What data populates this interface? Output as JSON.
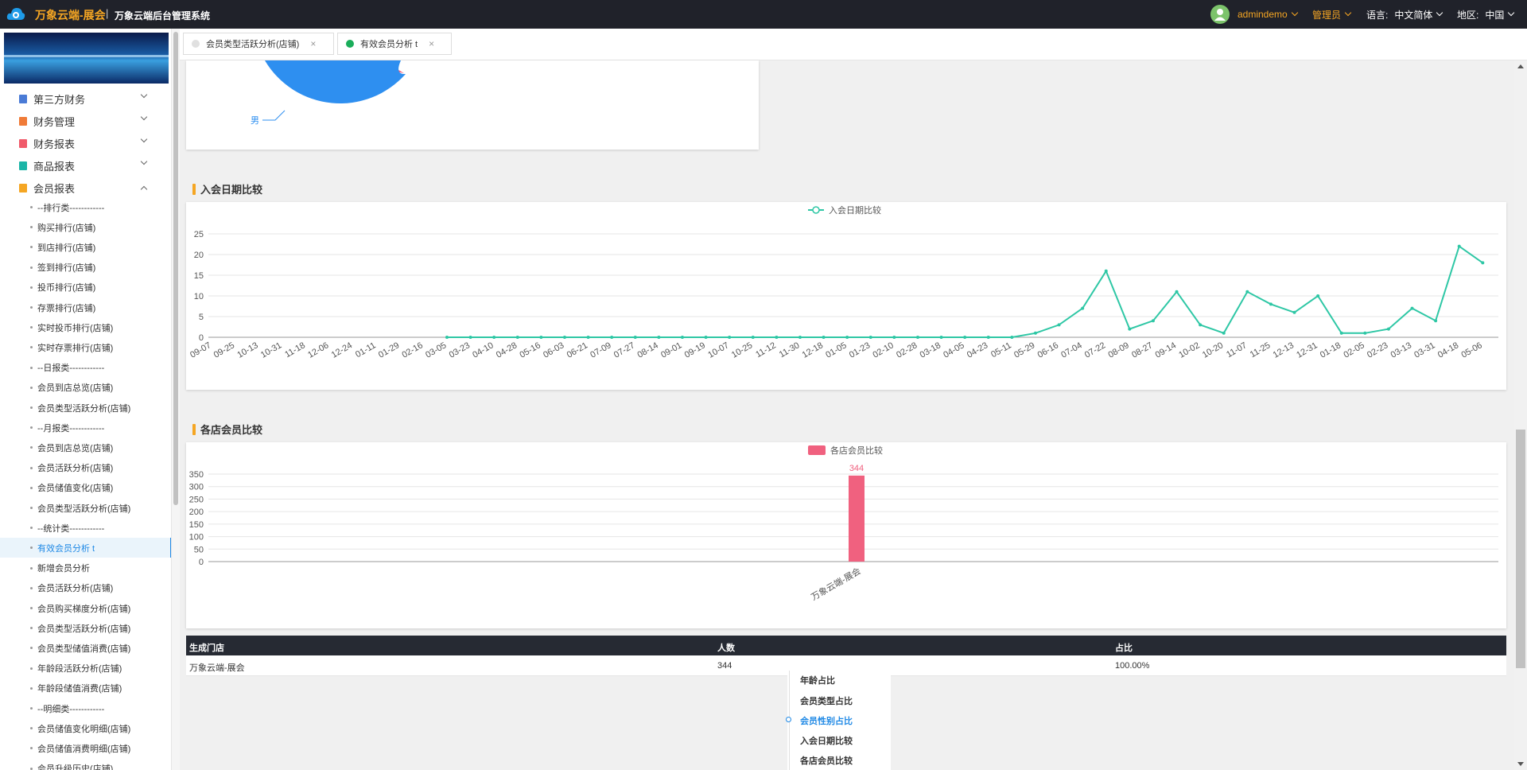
{
  "topbar": {
    "brand": "万象云端-展会",
    "separator": "|",
    "subtitle": "万象云端后台管理系统",
    "user": "admindemo",
    "role": "管理员",
    "language_label": "语言:",
    "language_value": "中文简体",
    "region_label": "地区:",
    "region_value": "中国",
    "brand_color": "#f5a623"
  },
  "sidebar": {
    "menus": [
      {
        "label": "第三方财务",
        "icon_color": "#4a7bd6",
        "icon": "document-icon"
      },
      {
        "label": "财务管理",
        "icon_color": "#f07b38",
        "icon": "ledger-icon"
      },
      {
        "label": "财务报表",
        "icon_color": "#f05a6a",
        "icon": "report-icon"
      },
      {
        "label": "商品报表",
        "icon_color": "#1bb5a7",
        "icon": "goods-icon"
      },
      {
        "label": "会员报表",
        "icon_color": "#f5a623",
        "icon": "member-icon"
      }
    ],
    "sub_items": [
      "--排行类------------",
      "购买排行(店铺)",
      "到店排行(店铺)",
      "签到排行(店铺)",
      "投币排行(店铺)",
      "存票排行(店铺)",
      "实时投币排行(店铺)",
      "实时存票排行(店铺)",
      "--日报类------------",
      "会员到店总览(店铺)",
      "会员类型活跃分析(店铺)",
      "--月报类------------",
      "会员到店总览(店铺)",
      "会员活跃分析(店铺)",
      "会员储值变化(店铺)",
      "会员类型活跃分析(店铺)",
      "--统计类------------",
      "有效会员分析 t",
      "新增会员分析",
      "会员活跃分析(店铺)",
      "会员购买梯度分析(店铺)",
      "会员类型活跃分析(店铺)",
      "会员类型储值消费(店铺)",
      "年龄段活跃分析(店铺)",
      "年龄段储值消费(店铺)",
      "--明细类------------",
      "会员储值变化明细(店铺)",
      "会员储值消费明细(店铺)",
      "会员升级历史(店铺)"
    ],
    "active_index": 17
  },
  "tabs": [
    {
      "label": "会员类型活跃分析(店铺)",
      "dot_color": "#e0e0e0",
      "close": "×"
    },
    {
      "label": "有效会员分析 t",
      "dot_color": "#1aad5a",
      "close": "×"
    }
  ],
  "sections": {
    "join_date_title": "入会日期比较",
    "store_title": "各店会员比较"
  },
  "chart_data": [
    {
      "type": "pie",
      "title": "",
      "labels": [
        "男"
      ],
      "colors": [
        "#2e8ff0",
        "#f0617f"
      ],
      "note_visible_label": "男"
    },
    {
      "type": "line",
      "legend": [
        "入会日期比较"
      ],
      "color": "#2ec7a5",
      "ylim": [
        0,
        25
      ],
      "yticks": [
        0,
        5,
        10,
        15,
        20,
        25
      ],
      "x_tick_labels": [
        "09-07",
        "09-25",
        "10-13",
        "10-31",
        "11-18",
        "12-06",
        "12-24",
        "01-11",
        "01-29",
        "02-16",
        "03-05",
        "03-23",
        "04-10",
        "04-28",
        "05-16",
        "06-03",
        "06-21",
        "07-09",
        "07-27",
        "08-14",
        "09-01",
        "09-19",
        "10-07",
        "10-25",
        "11-12",
        "11-30",
        "12-18",
        "01-05",
        "01-23",
        "02-10",
        "02-28",
        "03-18",
        "04-05",
        "04-23",
        "05-11",
        "05-29",
        "06-16",
        "07-04",
        "07-22",
        "08-09",
        "08-27",
        "09-14",
        "10-02",
        "10-20",
        "11-07",
        "11-25",
        "12-13",
        "12-31",
        "01-18",
        "02-05",
        "02-23",
        "03-13",
        "03-31",
        "04-18",
        "05-06"
      ],
      "series": [
        {
          "name": "入会日期比较",
          "x": [
            "09-07",
            "09-25",
            "10-13",
            "10-31",
            "11-18",
            "12-06",
            "12-24",
            "01-11",
            "01-29",
            "02-16",
            "03-05",
            "03-23",
            "04-10",
            "04-28",
            "05-16",
            "06-03",
            "06-21",
            "07-09",
            "07-27",
            "08-14",
            "09-01",
            "09-19",
            "10-07",
            "10-25",
            "11-12",
            "11-30",
            "12-18",
            "01-05",
            "01-23",
            "02-10",
            "02-28",
            "03-18",
            "04-05",
            "04-23",
            "05-11",
            "05-29",
            "06-16",
            "07-04",
            "07-22",
            "08-09",
            "08-27",
            "09-14",
            "10-02",
            "10-20",
            "11-07",
            "11-25",
            "12-13",
            "12-31",
            "01-18",
            "02-05",
            "02-23",
            "03-13",
            "03-31",
            "04-18",
            "05-06"
          ],
          "values": [
            0,
            0,
            0,
            0,
            0,
            0,
            0,
            0,
            0,
            0,
            0,
            0,
            0,
            0,
            0,
            0,
            0,
            0,
            0,
            0,
            0,
            0,
            0,
            0,
            0,
            0,
            0,
            0,
            0,
            0,
            0,
            0,
            0,
            0,
            0,
            1,
            3,
            7,
            16,
            2,
            4,
            11,
            3,
            1,
            11,
            8,
            6,
            10,
            1,
            1,
            2,
            7,
            4,
            22,
            18
          ]
        }
      ]
    },
    {
      "type": "bar",
      "legend": [
        "各店会员比较"
      ],
      "color": "#f0617f",
      "categories": [
        "万象云端-展会"
      ],
      "values": [
        344
      ],
      "ylim": [
        0,
        350
      ],
      "yticks": [
        0,
        50,
        100,
        150,
        200,
        250,
        300,
        350
      ],
      "data_labels": [
        "344"
      ]
    }
  ],
  "table": {
    "headers": [
      "生成门店",
      "人数",
      "占比"
    ],
    "rows": [
      [
        "万象云端-展会",
        "344",
        "100.00%"
      ]
    ]
  },
  "anchor_nav": {
    "items": [
      "年龄占比",
      "会员类型占比",
      "会员性别占比",
      "入会日期比较",
      "各店会员比较"
    ],
    "active_index": 2
  }
}
